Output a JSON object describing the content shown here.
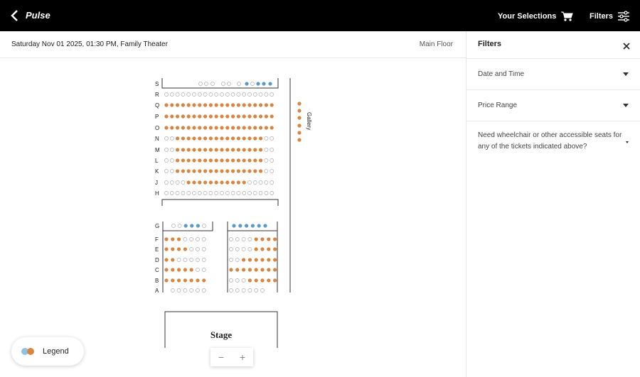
{
  "header": {
    "app_title": "Pulse",
    "selections_label": "Your Selections",
    "filters_label": "Filters"
  },
  "event": {
    "info": "Saturday Nov 01 2025, 01:30 PM, Family Theater",
    "level": "Main Floor"
  },
  "filters_panel": {
    "title": "Filters",
    "items": [
      {
        "label": "Date and Time"
      },
      {
        "label": "Price Range"
      },
      {
        "label": "Need wheelchair or other accessible seats for any of the tickets indicated above?"
      }
    ]
  },
  "seatmap": {
    "gallery_label": "Gallery",
    "stage_label": "Stage",
    "upper_rows": [
      "S",
      "R",
      "Q",
      "P",
      "O",
      "N",
      "M",
      "L",
      "K",
      "J",
      "H"
    ],
    "lower_rows": [
      "G",
      "F",
      "E",
      "D",
      "C",
      "B",
      "A"
    ]
  },
  "legend": {
    "label": "Legend"
  },
  "zoom": {
    "minus": "−",
    "plus": "+"
  },
  "colors": {
    "available": "#d8863f",
    "unavailable_stroke": "#bdbdbd",
    "accessible": "#5b9bc7",
    "header_bg": "#000000"
  }
}
